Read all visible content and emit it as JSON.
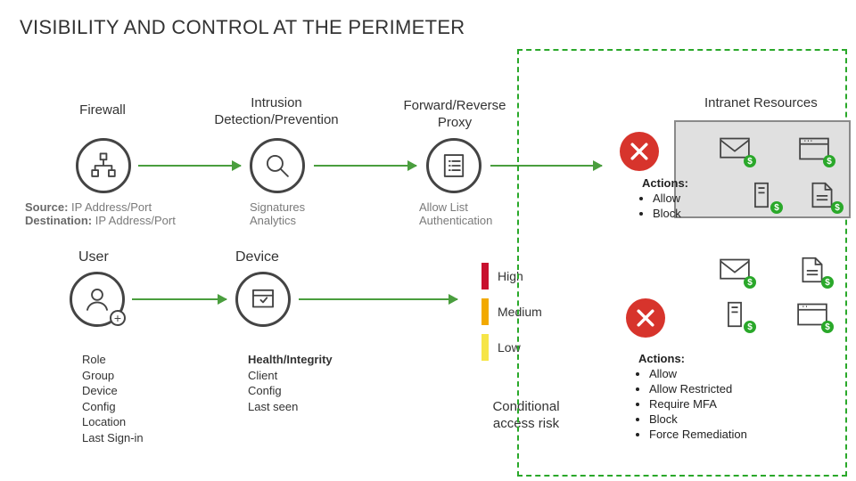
{
  "title": "VISIBILITY AND CONTROL AT THE PERIMETER",
  "row1": {
    "firewall": {
      "label": "Firewall",
      "sub": "<b>Source:</b> IP Address/Port<br><b>Destination:</b> IP Address/Port"
    },
    "idp": {
      "label": "Intrusion\nDetection/Prevention",
      "sub": "Signatures<br>Analytics"
    },
    "proxy": {
      "label": "Forward/Reverse\nProxy",
      "sub": "Allow List<br>Authentication"
    }
  },
  "row2": {
    "user": {
      "label": "User",
      "attrs": [
        "Role",
        "Group",
        "Device",
        "Config",
        "Location",
        "Last Sign-in"
      ]
    },
    "device": {
      "label": "Device",
      "attrs": [
        "Health/Integrity",
        "Client",
        "Config",
        "Last seen"
      ]
    }
  },
  "risk": {
    "high": "High",
    "medium": "Medium",
    "low": "Low",
    "colors": {
      "high": "#c8102e",
      "medium": "#f2a900",
      "low": "#f6e547"
    }
  },
  "ca_label": "Conditional access risk",
  "intranet_title": "Intranet Resources",
  "actions1": {
    "header": "Actions:",
    "items": [
      "Allow",
      "Block"
    ]
  },
  "actions2": {
    "header": "Actions:",
    "items": [
      "Allow",
      "Allow Restricted",
      "Require MFA",
      "Block",
      "Force Remediation"
    ]
  },
  "badge": "$"
}
